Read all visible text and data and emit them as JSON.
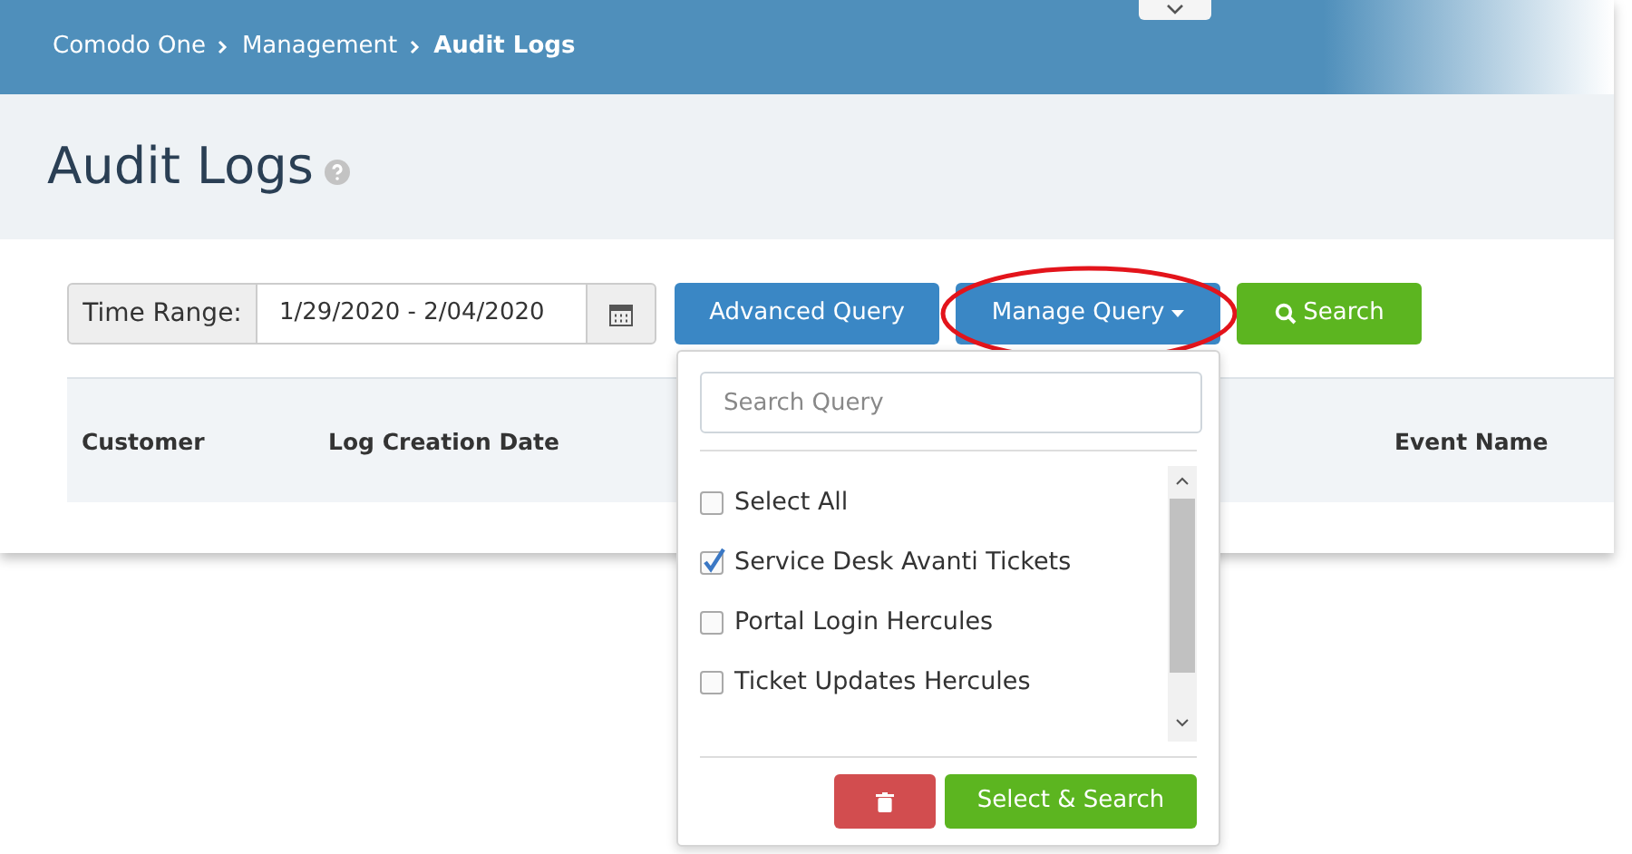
{
  "breadcrumb": [
    {
      "label": "Comodo One",
      "current": false
    },
    {
      "label": "Management",
      "current": false
    },
    {
      "label": "Audit Logs",
      "current": true
    }
  ],
  "page_title": "Audit Logs",
  "toolbar": {
    "time_range_label": "Time Range:",
    "time_range_value": "1/29/2020 - 2/04/2020",
    "buttons": [
      {
        "label": "Advanced Query",
        "kind": "primary",
        "highlighted": false
      },
      {
        "label": "Manage Query",
        "kind": "dropdown",
        "highlighted": true
      },
      {
        "label": "Search",
        "kind": "search",
        "highlighted": false
      }
    ]
  },
  "table": {
    "columns": [
      "Customer",
      "Log Creation Date",
      "Event Name"
    ]
  },
  "query_menu": {
    "search_placeholder": "Search Query",
    "items": [
      {
        "label": "Select All",
        "checked": false
      },
      {
        "label": "Service Desk Avanti Tickets",
        "checked": true
      },
      {
        "label": "Portal Login Hercules",
        "checked": false
      },
      {
        "label": "Ticket Updates Hercules",
        "checked": false
      }
    ],
    "confirm_label": "Select & Search"
  }
}
